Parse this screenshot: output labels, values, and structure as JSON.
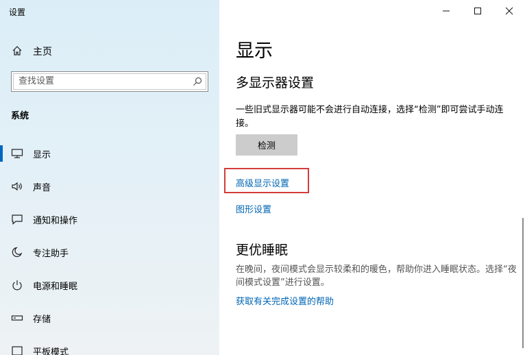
{
  "app": {
    "title": "设置"
  },
  "sidebar": {
    "home_label": "主页",
    "search_placeholder": "查找设置",
    "section_title": "系统",
    "items": [
      {
        "label": "显示",
        "icon": "monitor-icon",
        "active": true
      },
      {
        "label": "声音",
        "icon": "speaker-icon",
        "active": false
      },
      {
        "label": "通知和操作",
        "icon": "notification-icon",
        "active": false
      },
      {
        "label": "专注助手",
        "icon": "moon-icon",
        "active": false
      },
      {
        "label": "电源和睡眠",
        "icon": "power-icon",
        "active": false
      },
      {
        "label": "存储",
        "icon": "storage-icon",
        "active": false
      },
      {
        "label": "平板模式",
        "icon": "tablet-icon",
        "active": false
      }
    ]
  },
  "window_controls": {
    "minimize": "minimize-icon",
    "maximize": "maximize-icon",
    "close": "close-icon"
  },
  "main": {
    "title": "显示",
    "multi_display": {
      "heading": "多显示器设置",
      "description": "一些旧式显示器可能不会进行自动连接，选择“检测”即可尝试手动连接。",
      "detect_button": "检测",
      "advanced_link": "高级显示设置",
      "graphics_link": "图形设置"
    },
    "sleep": {
      "heading": "更优睡眠",
      "description": "在晚间，夜间模式会显示较柔和的暖色，帮助你进入睡眠状态。选择“夜间模式设置”进行设置。",
      "help_link": "获取有关完成设置的帮助"
    }
  },
  "colors": {
    "accent": "#0067c0",
    "link": "#0066b4",
    "highlight_box": "#d33b3b"
  }
}
